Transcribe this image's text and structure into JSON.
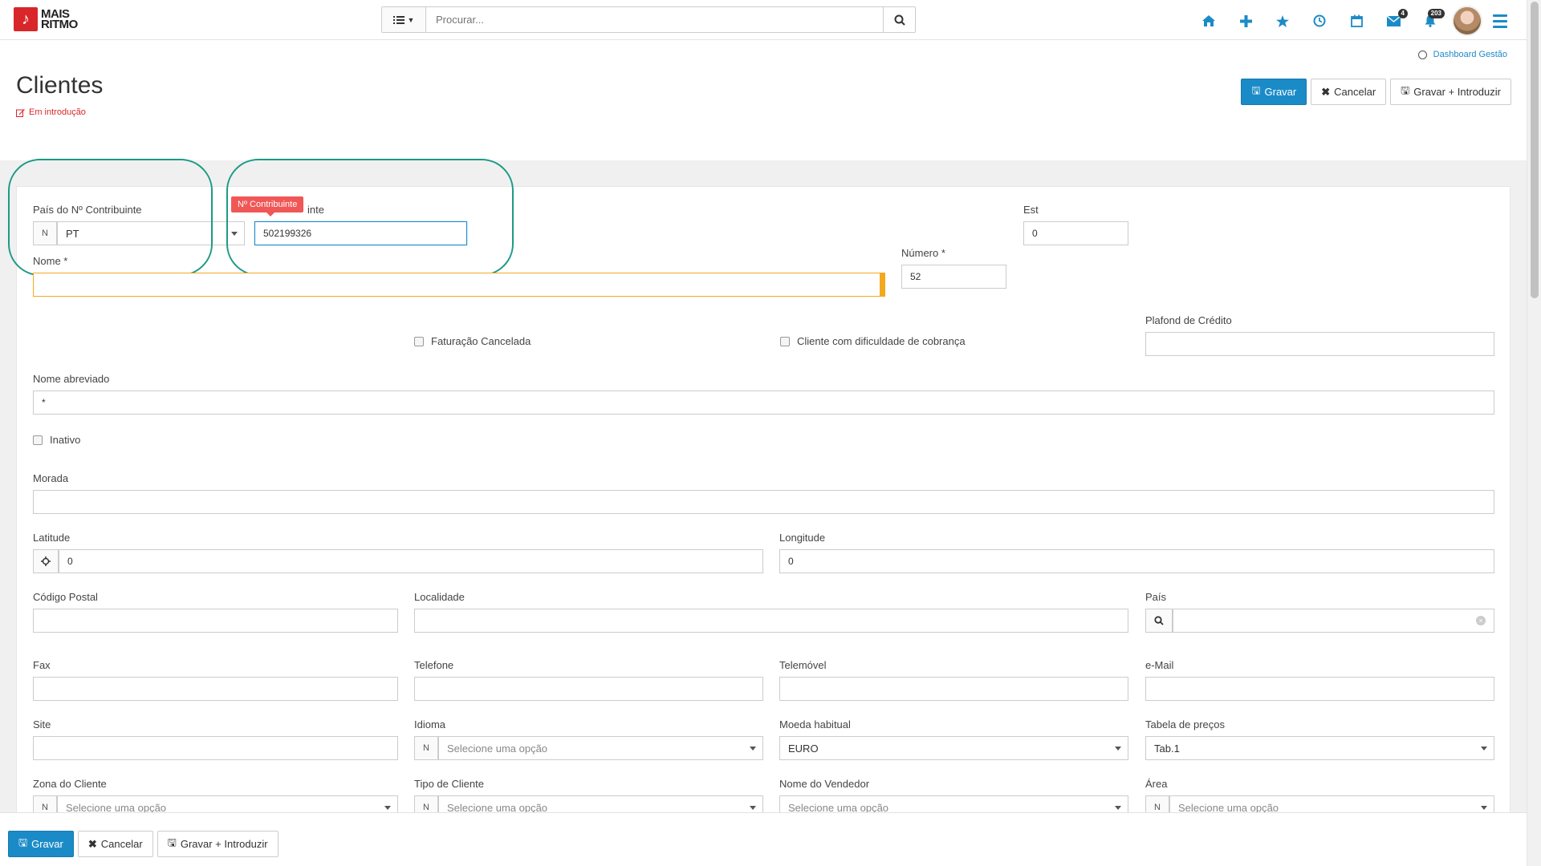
{
  "app": {
    "logo_line1": "MAIS",
    "logo_line2": "RITMO"
  },
  "search": {
    "placeholder": "Procurar..."
  },
  "nav": {
    "mail_badge": "4",
    "notif_badge": "203"
  },
  "header": {
    "dashboard_link": "Dashboard Gestão",
    "title": "Clientes",
    "status": "Em introdução",
    "save_label": "Gravar",
    "cancel_label": "Cancelar",
    "save_insert_label": "Gravar + Introduzir"
  },
  "form": {
    "pais_contribuinte": {
      "label": "País do Nº Contribuinte",
      "prefix": "N",
      "value": "PT"
    },
    "contribuinte": {
      "label": "Nº Contribuinte",
      "label_visible": "inte",
      "value": "502199326",
      "tooltip": "Nº Contribuinte"
    },
    "est": {
      "label": "Est",
      "value": "0"
    },
    "nome": {
      "label": "Nome *",
      "value": ""
    },
    "numero": {
      "label": "Número *",
      "value": "52"
    },
    "faturacao_cancelada": {
      "label": "Faturação Cancelada"
    },
    "dificuldade_cobranca": {
      "label": "Cliente com dificuldade de cobrança"
    },
    "plafond": {
      "label": "Plafond de Crédito",
      "value": ""
    },
    "nome_abreviado": {
      "label": "Nome abreviado",
      "value": "*"
    },
    "inativo": {
      "label": "Inativo"
    },
    "morada": {
      "label": "Morada",
      "value": ""
    },
    "latitude": {
      "label": "Latitude",
      "value": "0"
    },
    "longitude": {
      "label": "Longitude",
      "value": "0"
    },
    "codigo_postal": {
      "label": "Código Postal",
      "value": ""
    },
    "localidade": {
      "label": "Localidade",
      "value": ""
    },
    "pais": {
      "label": "País",
      "value": ""
    },
    "fax": {
      "label": "Fax",
      "value": ""
    },
    "telefone": {
      "label": "Telefone",
      "value": ""
    },
    "telemovel": {
      "label": "Telemóvel",
      "value": ""
    },
    "email": {
      "label": "e-Mail",
      "value": ""
    },
    "site": {
      "label": "Site",
      "value": ""
    },
    "idioma": {
      "label": "Idioma",
      "prefix": "N",
      "value": "Selecione uma opção"
    },
    "moeda": {
      "label": "Moeda habitual",
      "value": "EURO"
    },
    "tabela_precos": {
      "label": "Tabela de preços",
      "value": "Tab.1"
    },
    "zona": {
      "label": "Zona do Cliente",
      "prefix": "N",
      "value": "Selecione uma opção"
    },
    "tipo": {
      "label": "Tipo de Cliente",
      "prefix": "N",
      "value": "Selecione uma opção"
    },
    "vendedor": {
      "label": "Nome do Vendedor",
      "value": "Selecione uma opção"
    },
    "area": {
      "label": "Área",
      "prefix": "N",
      "value": "Selecione uma opção"
    }
  },
  "footer": {
    "save_label": "Gravar",
    "cancel_label": "Cancelar",
    "save_insert_label": "Gravar + Introduzir"
  },
  "colors": {
    "accent": "#1b8bc7",
    "brand": "#d9262a",
    "highlight_circle": "#1d9a85",
    "tooltip": "#f05757",
    "warning": "#f3a91e"
  }
}
